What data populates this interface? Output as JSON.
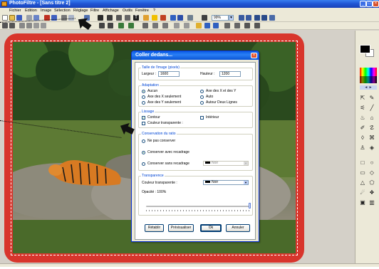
{
  "window": {
    "title": "PhotoFiltre - [Sans titre 2]",
    "controls": [
      "_",
      "□",
      "×"
    ]
  },
  "menu": [
    "Fichier",
    "Edition",
    "Image",
    "Sélection",
    "Réglage",
    "Filtre",
    "Affichage",
    "Outils",
    "Fenêtre",
    "?"
  ],
  "toolbar": {
    "zoom_value": "99%",
    "zoom_arrow": "▼"
  },
  "tools_panel": {
    "palette_arrows": "◄ ►"
  },
  "dialog": {
    "title": "Coller dedans...",
    "close": "×",
    "image_size": {
      "title": "Taille de l'image (pixels)",
      "width_label": "Largeur :",
      "width_value": "1600",
      "height_label": "Hauteur :",
      "height_value": "1200"
    },
    "adaptation": {
      "title": "Adaptation",
      "options": [
        "Aucun",
        "Axe des X et des Y",
        "Axe des X seulement",
        "Auto",
        "Axe des Y seulement",
        "Autour Deux Lignes"
      ],
      "selected": "Aucun"
    },
    "lissage": {
      "title": "Lissage",
      "contour": "Contour",
      "contour_checked": true,
      "interieur": "Intérieur",
      "interieur_checked": false,
      "couleur_transparente": "Couleur transparente :",
      "couleur_transparente_checked": false
    },
    "ratio": {
      "title": "Conservation du ratio",
      "options": [
        "Ne pas conserver",
        "Conserver avec recadrage",
        "Conserver sans recadrage"
      ],
      "selected": "Conserver avec recadrage",
      "color_value": "Noir"
    },
    "transparence": {
      "title": "Transparence",
      "couleur_label": "Couleur transparente :",
      "couleur_value": "Noir",
      "opacity_label": "Opacité : 100%",
      "opacity_value": 100
    },
    "buttons": {
      "reset": "Rétablir",
      "preview": "Prévisualiser",
      "ok": "Ok",
      "cancel": "Annuler"
    }
  },
  "colors": {
    "canvas_border": "#d8352c",
    "title_gradient": "#2157d6",
    "dialog_accent": "#0046d5"
  }
}
